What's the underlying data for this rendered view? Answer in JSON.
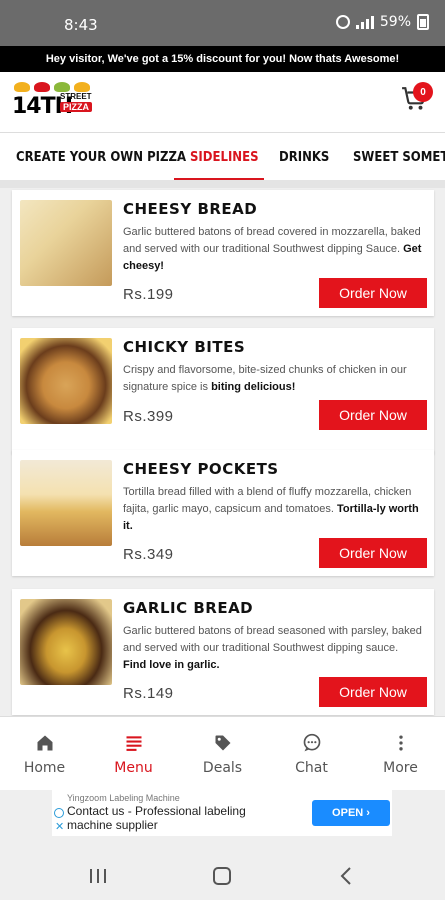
{
  "status_bar": {
    "time": "8:43",
    "battery": "59%"
  },
  "promo": {
    "text": "Hey visitor, We've got a 15% discount for you! Now thats Awesome!"
  },
  "header": {
    "logo": {
      "number": "14TH",
      "street": "STREET",
      "pizza": "PIZZA"
    },
    "cart_count": "0"
  },
  "tabs": [
    {
      "label": "CREATE YOUR OWN PIZZA"
    },
    {
      "label": "SIDELINES"
    },
    {
      "label": "DRINKS"
    },
    {
      "label": "SWEET SOMETHI"
    }
  ],
  "products": [
    {
      "title": "CHEESY BREAD",
      "desc": "Garlic buttered batons of bread covered in mozzarella, baked and served with our traditional Southwest dipping Sauce.",
      "tagline": "Get cheesy!",
      "price": "Rs.199",
      "button": "Order Now"
    },
    {
      "title": "CHICKY BITES",
      "desc": "Crispy and flavorsome, bite-sized chunks of chicken in our signature spice is",
      "tagline": "biting delicious!",
      "price": "Rs.399",
      "button": "Order Now"
    },
    {
      "title": "CHEESY POCKETS",
      "desc": "Tortilla bread filled with a blend of fluffy mozzarella, chicken fajita, garlic mayo, capsicum and tomatoes.",
      "tagline": "Tortilla-ly worth it.",
      "price": "Rs.349",
      "button": "Order Now"
    },
    {
      "title": "GARLIC BREAD",
      "desc": "Garlic buttered batons of bread seasoned with parsley, baked and served with our traditional Southwest dipping sauce.",
      "tagline": "Find love in garlic.",
      "price": "Rs.149",
      "button": "Order Now"
    }
  ],
  "bottom_nav": [
    {
      "label": "Home",
      "icon": "home-icon"
    },
    {
      "label": "Menu",
      "icon": "menu-icon"
    },
    {
      "label": "Deals",
      "icon": "tag-icon"
    },
    {
      "label": "Chat",
      "icon": "chat-icon"
    },
    {
      "label": "More",
      "icon": "more-vertical-icon"
    }
  ],
  "ad": {
    "brand": "Yingzoom Labeling Machine",
    "text": "Contact us - Professional labeling machine supplier",
    "button": "OPEN ›"
  },
  "colors": {
    "accent": "#e3141c",
    "banner_bg": "#000000",
    "status_bg": "#6b6b6b"
  }
}
